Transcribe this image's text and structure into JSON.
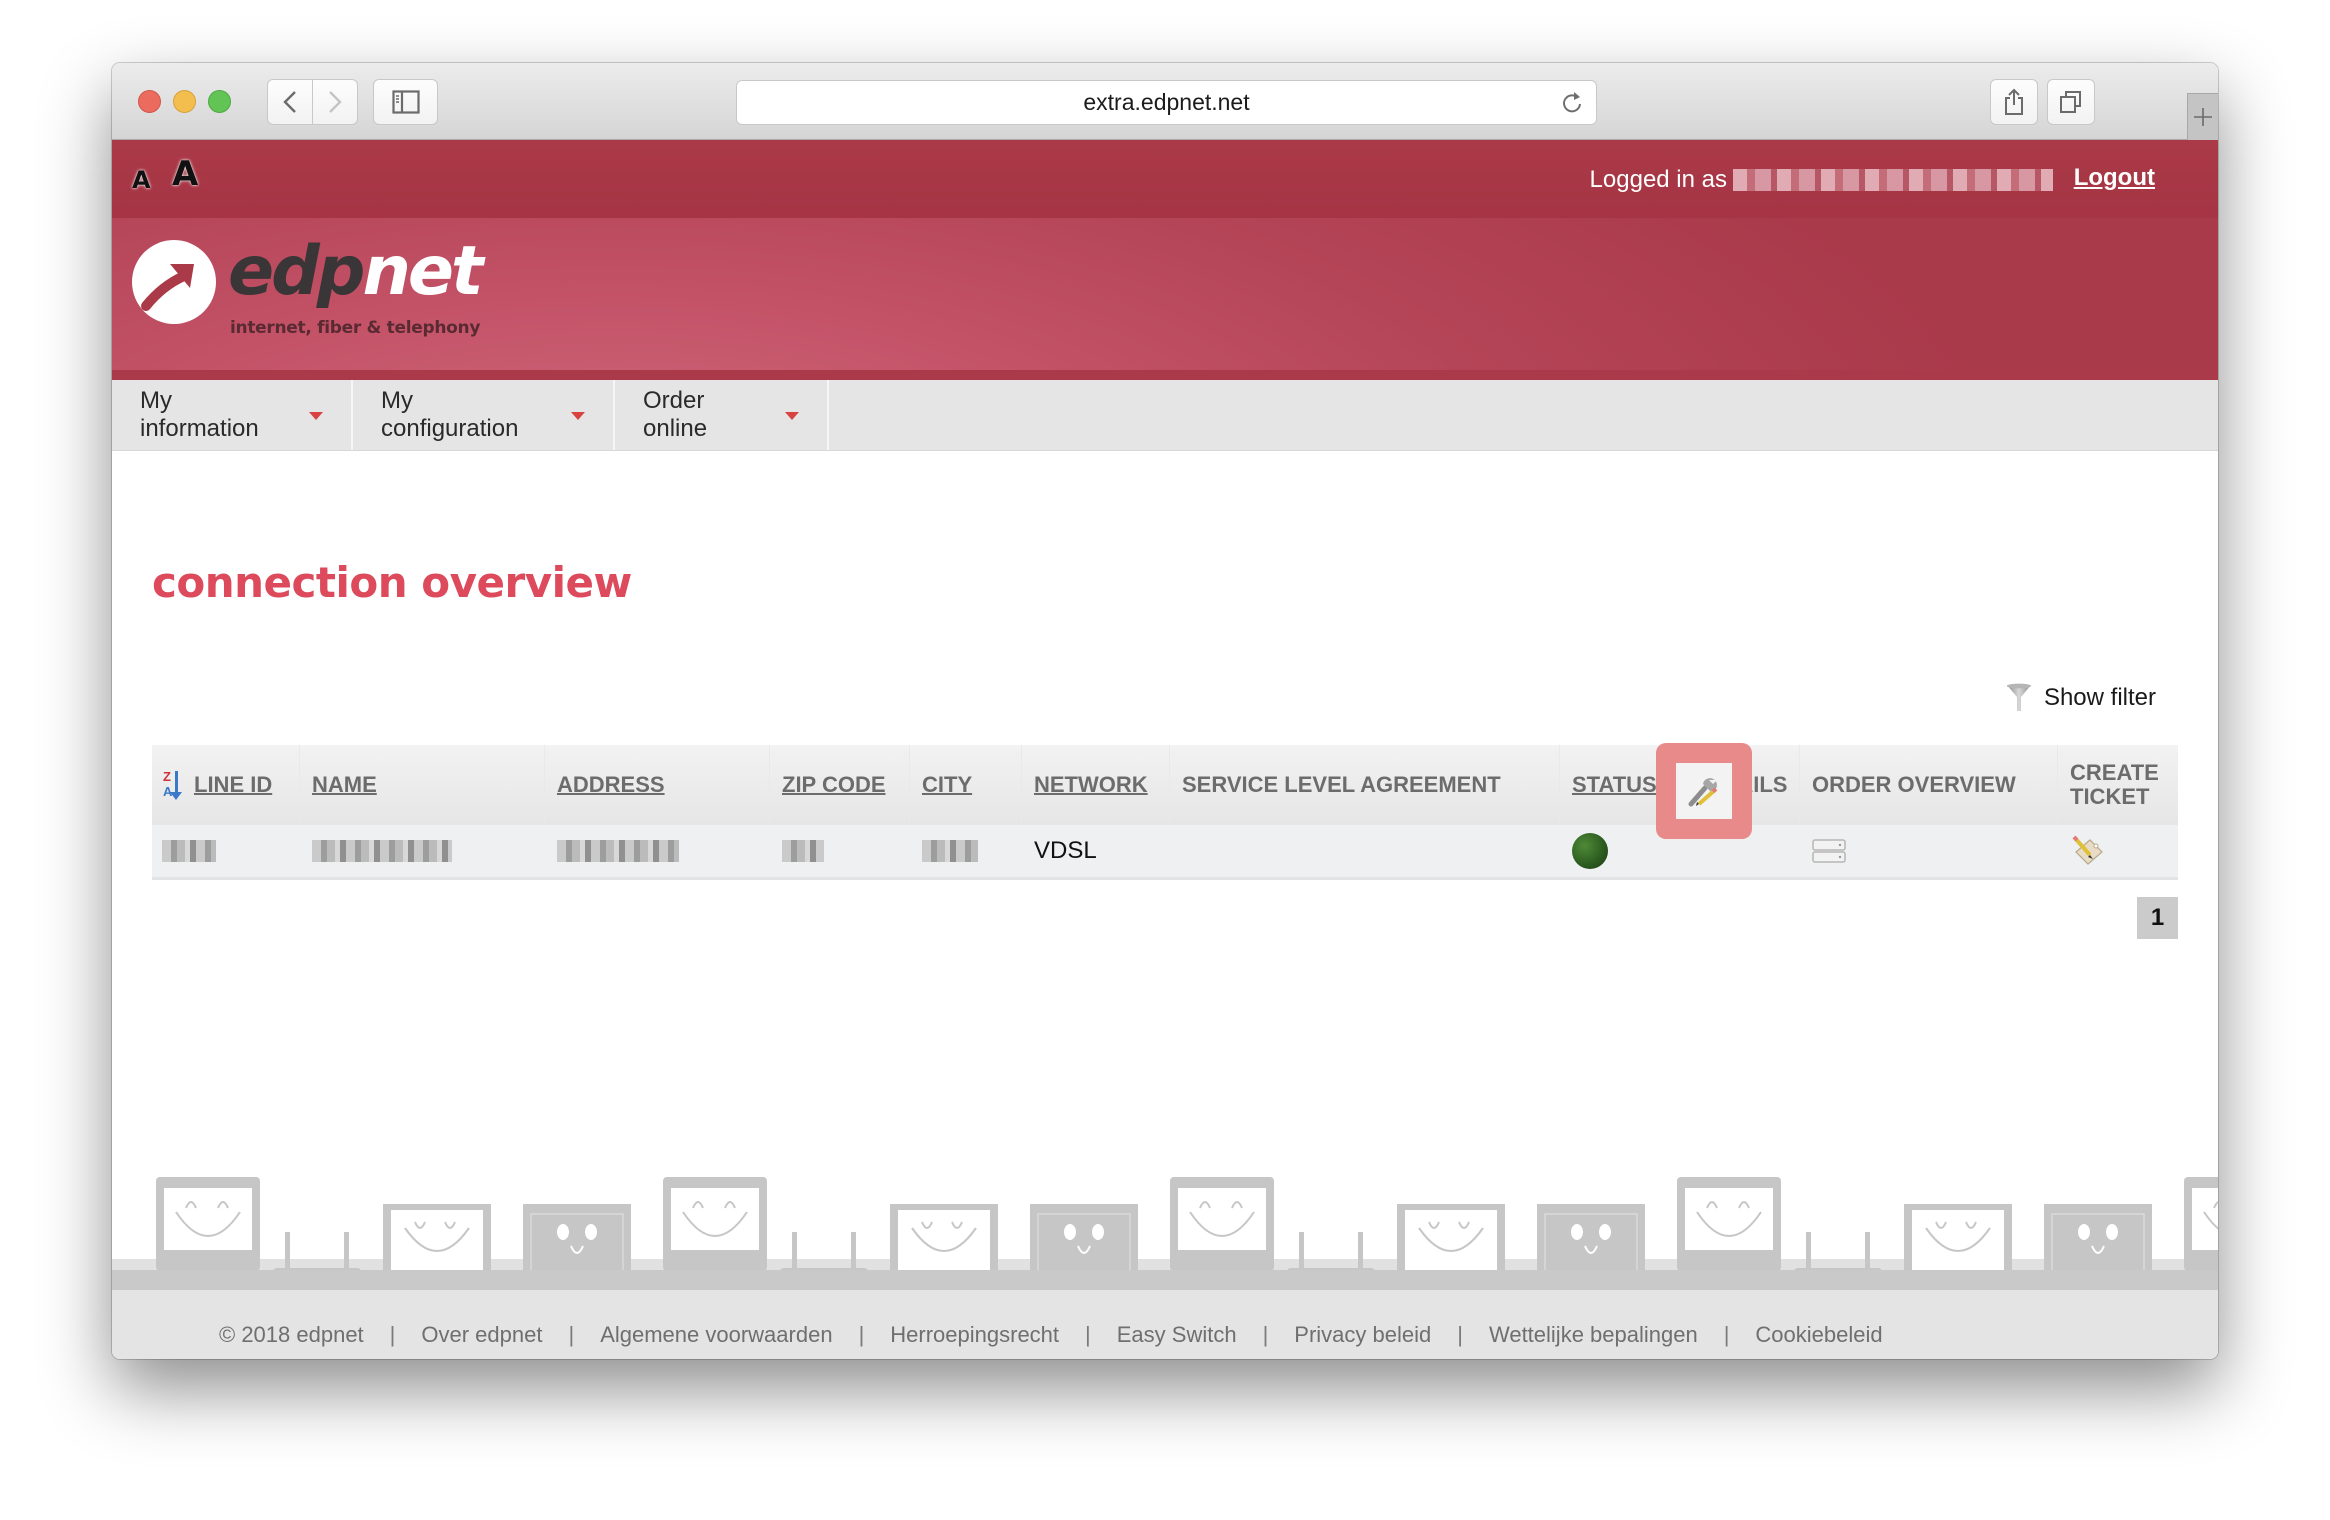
{
  "browser": {
    "url": "extra.edpnet.net"
  },
  "topbar": {
    "font_small": "A",
    "font_large": "A",
    "logged_in_label": "Logged in as",
    "logout_label": "Logout"
  },
  "logo": {
    "word_dark": "edp",
    "word_light": "net",
    "tagline": "internet, fiber & telephony"
  },
  "nav": {
    "items": [
      {
        "label": "My information"
      },
      {
        "label": "My configuration"
      },
      {
        "label": "Order online"
      }
    ]
  },
  "main": {
    "title": "connection overview",
    "show_filter_label": "Show filter",
    "table": {
      "columns": [
        {
          "label": "LINE ID",
          "sortable": true
        },
        {
          "label": "NAME",
          "sortable": true
        },
        {
          "label": "ADDRESS",
          "sortable": true
        },
        {
          "label": "ZIP CODE",
          "sortable": true
        },
        {
          "label": "CITY",
          "sortable": true
        },
        {
          "label": "NETWORK",
          "sortable": true
        },
        {
          "label": "SERVICE LEVEL AGREEMENT",
          "sortable": false
        },
        {
          "label": "STATUS",
          "sortable": true
        },
        {
          "label": "DETAILS",
          "sortable": false
        },
        {
          "label": "ORDER OVERVIEW",
          "sortable": false
        },
        {
          "label": "CREATE TICKET",
          "sortable": false
        }
      ],
      "rows": [
        {
          "line_id": "[redacted]",
          "name": "[redacted]",
          "address": "[redacted]",
          "zip_code": "[redacted]",
          "city": "[redacted]",
          "network": "VDSL",
          "service_level_agreement": "",
          "status": "active",
          "status_color": "#2f6322",
          "details_icon": "wrench-pencil-icon",
          "order_overview_icon": "order-overview-icon",
          "create_ticket_icon": "ticket-pencil-icon"
        }
      ]
    },
    "pagination": {
      "current_page": "1"
    }
  },
  "footer": {
    "links": [
      {
        "label": "© 2018 edpnet"
      },
      {
        "label": "Over edpnet"
      },
      {
        "label": "Algemene voorwaarden"
      },
      {
        "label": "Herroepingsrecht"
      },
      {
        "label": "Easy Switch"
      },
      {
        "label": "Privacy beleid"
      },
      {
        "label": "Wettelijke bepalingen"
      },
      {
        "label": "Cookiebeleid"
      }
    ]
  },
  "colors": {
    "brand_red": "#ab3a48",
    "title_red": "#dc4a5c",
    "highlight": "#e88a89"
  }
}
